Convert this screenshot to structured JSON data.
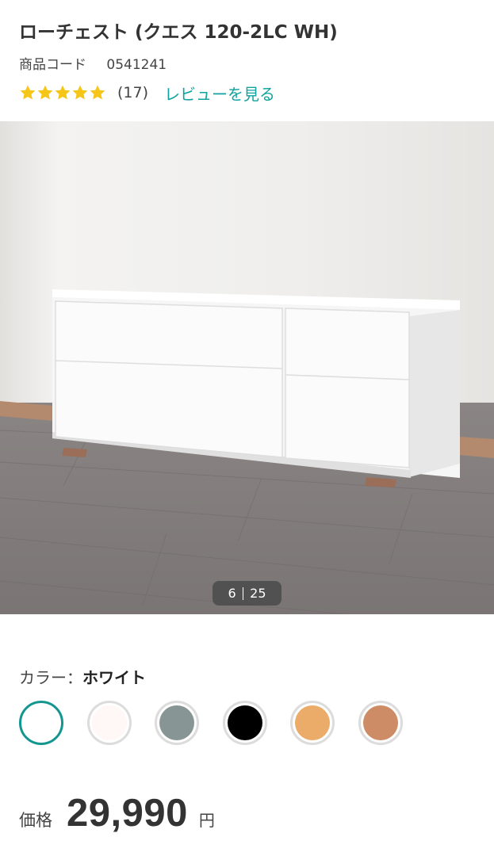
{
  "product": {
    "title": "ローチェスト (クエス 120-2LC WH)",
    "code_label": "商品コード",
    "code_value": "0541241",
    "rating": 5,
    "review_count": "(17)",
    "review_link": "レビューを見る",
    "star_color": "#f5c518"
  },
  "gallery": {
    "current": "6",
    "total": "25"
  },
  "color": {
    "label": "カラー：",
    "selected_name": "ホワイト",
    "options": [
      {
        "hex": "#ffffff",
        "selected": true
      },
      {
        "hex": "#fff8f6",
        "selected": false
      },
      {
        "hex": "#879694",
        "selected": false
      },
      {
        "hex": "#000000",
        "selected": false
      },
      {
        "hex": "#ecac69",
        "selected": false
      },
      {
        "hex": "#cd8c66",
        "selected": false
      }
    ]
  },
  "price": {
    "label": "価格",
    "value": "29,990",
    "unit": "円"
  },
  "colors": {
    "accent": "#13968f",
    "link": "#11a3a0"
  }
}
